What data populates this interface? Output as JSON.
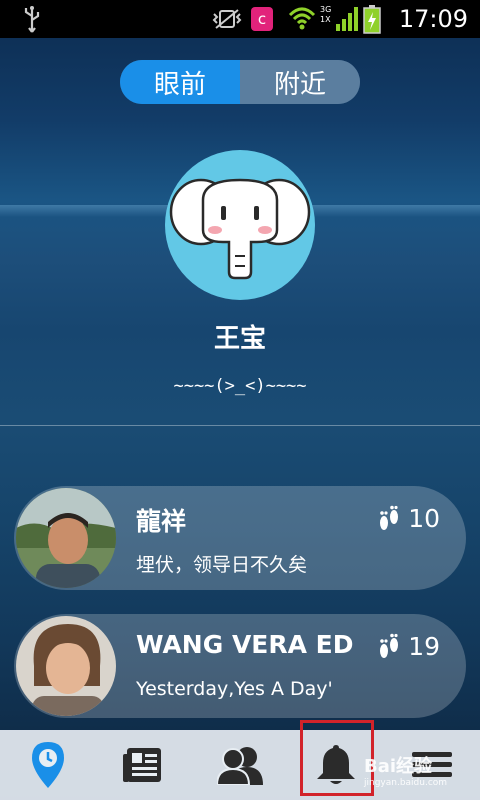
{
  "status_bar": {
    "time": "17:09",
    "network": "3G",
    "network_sub": "1X"
  },
  "segment": {
    "active_label": "眼前",
    "inactive_label": "附近"
  },
  "profile": {
    "name": "王宝",
    "signature": "~~~~(>_<)~~~~",
    "avatar_icon": "elephant-avatar"
  },
  "contacts": [
    {
      "name": "龍祥",
      "message": "埋伏，领导日不久矣",
      "steps": "10"
    },
    {
      "name": "WANG VERA ED",
      "message": "Yesterday,Yes A Day'",
      "steps": "19"
    }
  ],
  "tabbar": {
    "tabs": [
      "location-pin-icon",
      "news-icon",
      "people-icon",
      "bell-icon",
      "menu-icon"
    ],
    "active_color": "#1a8fe8"
  },
  "watermark": {
    "brand": "Bai经验",
    "url": "jingyan.baidu.com"
  },
  "colors": {
    "accent": "#1a8fe8",
    "highlight_box": "#d2232a",
    "avatar_bg": "#62c8e6"
  }
}
